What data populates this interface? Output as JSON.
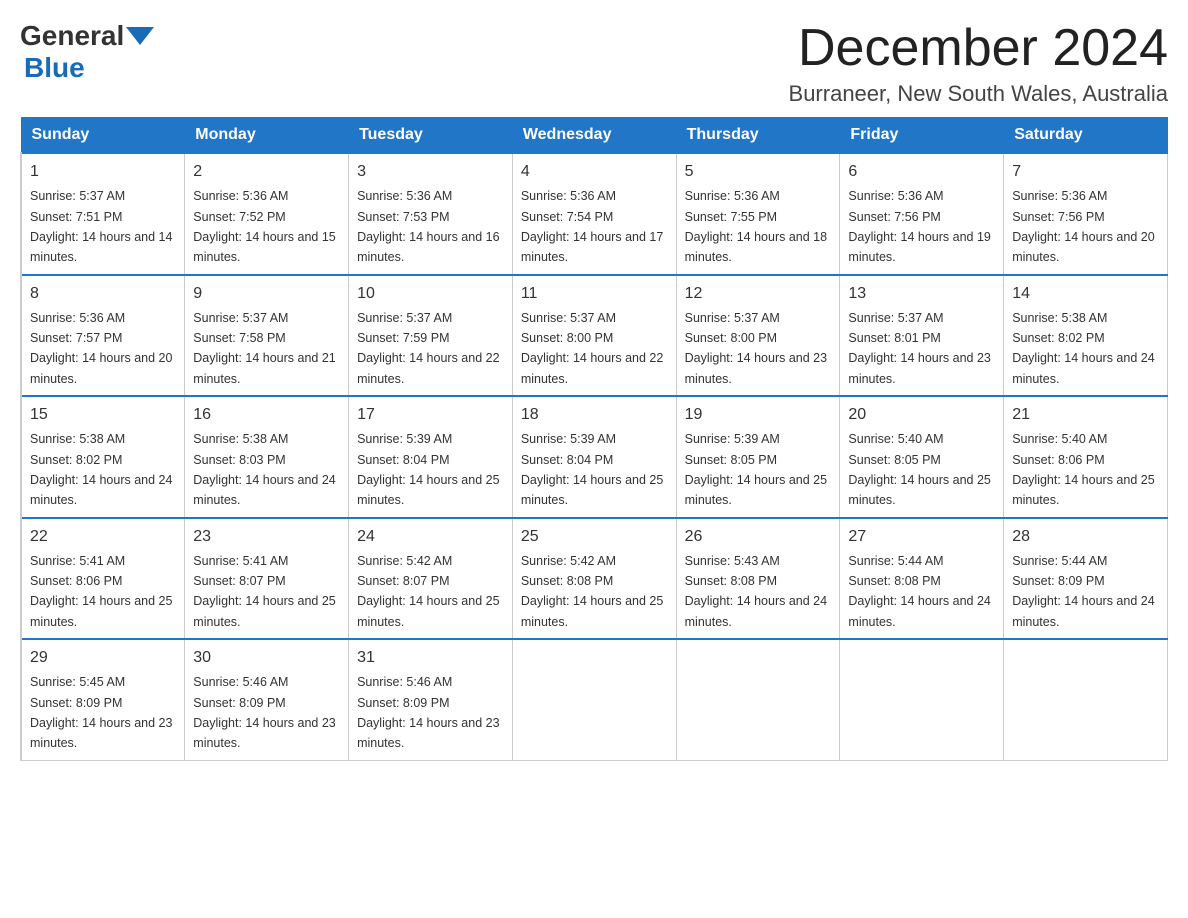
{
  "header": {
    "logo_general": "General",
    "logo_blue": "Blue",
    "month_title": "December 2024",
    "location": "Burraneer, New South Wales, Australia"
  },
  "days_of_week": [
    "Sunday",
    "Monday",
    "Tuesday",
    "Wednesday",
    "Thursday",
    "Friday",
    "Saturday"
  ],
  "weeks": [
    [
      {
        "day": "1",
        "sunrise": "5:37 AM",
        "sunset": "7:51 PM",
        "daylight": "14 hours and 14 minutes."
      },
      {
        "day": "2",
        "sunrise": "5:36 AM",
        "sunset": "7:52 PM",
        "daylight": "14 hours and 15 minutes."
      },
      {
        "day": "3",
        "sunrise": "5:36 AM",
        "sunset": "7:53 PM",
        "daylight": "14 hours and 16 minutes."
      },
      {
        "day": "4",
        "sunrise": "5:36 AM",
        "sunset": "7:54 PM",
        "daylight": "14 hours and 17 minutes."
      },
      {
        "day": "5",
        "sunrise": "5:36 AM",
        "sunset": "7:55 PM",
        "daylight": "14 hours and 18 minutes."
      },
      {
        "day": "6",
        "sunrise": "5:36 AM",
        "sunset": "7:56 PM",
        "daylight": "14 hours and 19 minutes."
      },
      {
        "day": "7",
        "sunrise": "5:36 AM",
        "sunset": "7:56 PM",
        "daylight": "14 hours and 20 minutes."
      }
    ],
    [
      {
        "day": "8",
        "sunrise": "5:36 AM",
        "sunset": "7:57 PM",
        "daylight": "14 hours and 20 minutes."
      },
      {
        "day": "9",
        "sunrise": "5:37 AM",
        "sunset": "7:58 PM",
        "daylight": "14 hours and 21 minutes."
      },
      {
        "day": "10",
        "sunrise": "5:37 AM",
        "sunset": "7:59 PM",
        "daylight": "14 hours and 22 minutes."
      },
      {
        "day": "11",
        "sunrise": "5:37 AM",
        "sunset": "8:00 PM",
        "daylight": "14 hours and 22 minutes."
      },
      {
        "day": "12",
        "sunrise": "5:37 AM",
        "sunset": "8:00 PM",
        "daylight": "14 hours and 23 minutes."
      },
      {
        "day": "13",
        "sunrise": "5:37 AM",
        "sunset": "8:01 PM",
        "daylight": "14 hours and 23 minutes."
      },
      {
        "day": "14",
        "sunrise": "5:38 AM",
        "sunset": "8:02 PM",
        "daylight": "14 hours and 24 minutes."
      }
    ],
    [
      {
        "day": "15",
        "sunrise": "5:38 AM",
        "sunset": "8:02 PM",
        "daylight": "14 hours and 24 minutes."
      },
      {
        "day": "16",
        "sunrise": "5:38 AM",
        "sunset": "8:03 PM",
        "daylight": "14 hours and 24 minutes."
      },
      {
        "day": "17",
        "sunrise": "5:39 AM",
        "sunset": "8:04 PM",
        "daylight": "14 hours and 25 minutes."
      },
      {
        "day": "18",
        "sunrise": "5:39 AM",
        "sunset": "8:04 PM",
        "daylight": "14 hours and 25 minutes."
      },
      {
        "day": "19",
        "sunrise": "5:39 AM",
        "sunset": "8:05 PM",
        "daylight": "14 hours and 25 minutes."
      },
      {
        "day": "20",
        "sunrise": "5:40 AM",
        "sunset": "8:05 PM",
        "daylight": "14 hours and 25 minutes."
      },
      {
        "day": "21",
        "sunrise": "5:40 AM",
        "sunset": "8:06 PM",
        "daylight": "14 hours and 25 minutes."
      }
    ],
    [
      {
        "day": "22",
        "sunrise": "5:41 AM",
        "sunset": "8:06 PM",
        "daylight": "14 hours and 25 minutes."
      },
      {
        "day": "23",
        "sunrise": "5:41 AM",
        "sunset": "8:07 PM",
        "daylight": "14 hours and 25 minutes."
      },
      {
        "day": "24",
        "sunrise": "5:42 AM",
        "sunset": "8:07 PM",
        "daylight": "14 hours and 25 minutes."
      },
      {
        "day": "25",
        "sunrise": "5:42 AM",
        "sunset": "8:08 PM",
        "daylight": "14 hours and 25 minutes."
      },
      {
        "day": "26",
        "sunrise": "5:43 AM",
        "sunset": "8:08 PM",
        "daylight": "14 hours and 24 minutes."
      },
      {
        "day": "27",
        "sunrise": "5:44 AM",
        "sunset": "8:08 PM",
        "daylight": "14 hours and 24 minutes."
      },
      {
        "day": "28",
        "sunrise": "5:44 AM",
        "sunset": "8:09 PM",
        "daylight": "14 hours and 24 minutes."
      }
    ],
    [
      {
        "day": "29",
        "sunrise": "5:45 AM",
        "sunset": "8:09 PM",
        "daylight": "14 hours and 23 minutes."
      },
      {
        "day": "30",
        "sunrise": "5:46 AM",
        "sunset": "8:09 PM",
        "daylight": "14 hours and 23 minutes."
      },
      {
        "day": "31",
        "sunrise": "5:46 AM",
        "sunset": "8:09 PM",
        "daylight": "14 hours and 23 minutes."
      },
      null,
      null,
      null,
      null
    ]
  ],
  "labels": {
    "sunrise_prefix": "Sunrise: ",
    "sunset_prefix": "Sunset: ",
    "daylight_prefix": "Daylight: "
  }
}
